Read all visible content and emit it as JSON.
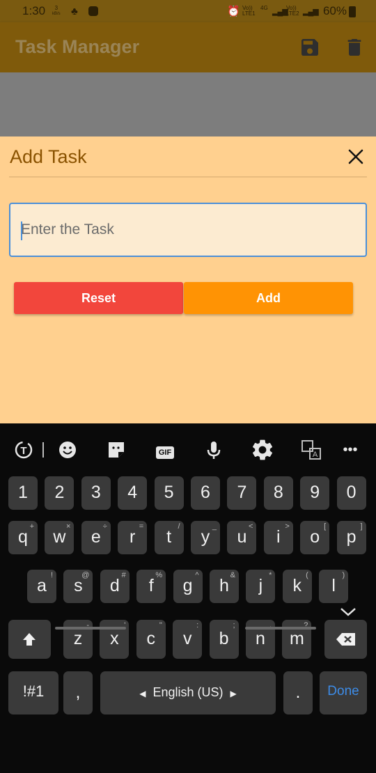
{
  "status_bar": {
    "time": "1:30",
    "data_speed_top": "3",
    "data_speed_bottom": "kB/s",
    "sim1": "Vo)) LTE1",
    "net": "4G",
    "sim2": "Vo)) LTE2",
    "battery": "60%"
  },
  "app_bar": {
    "title": "Task Manager",
    "icons": [
      "save-icon",
      "trash-icon"
    ]
  },
  "sheet": {
    "title": "Add Task",
    "close_icon": "close-icon",
    "input_placeholder": "Enter the Task",
    "input_value": "",
    "reset_label": "Reset",
    "add_label": "Add",
    "colors": {
      "reset": "#f2463c",
      "add": "#ff9304",
      "focus": "#4a8fd9"
    }
  },
  "keyboard": {
    "toolbar": [
      "text-recognition-icon",
      "emoji-icon",
      "sticker-icon",
      "gif-icon",
      "microphone-icon",
      "settings-icon",
      "translate-icon",
      "more-icon"
    ],
    "gif_label": "GIF",
    "number_row": [
      "1",
      "2",
      "3",
      "4",
      "5",
      "6",
      "7",
      "8",
      "9",
      "0"
    ],
    "row1": [
      {
        "k": "q",
        "s": "+"
      },
      {
        "k": "w",
        "s": "×"
      },
      {
        "k": "e",
        "s": "÷"
      },
      {
        "k": "r",
        "s": "="
      },
      {
        "k": "t",
        "s": "/"
      },
      {
        "k": "y",
        "s": "_"
      },
      {
        "k": "u",
        "s": "<"
      },
      {
        "k": "i",
        "s": ">"
      },
      {
        "k": "o",
        "s": "["
      },
      {
        "k": "p",
        "s": "]"
      }
    ],
    "row2": [
      {
        "k": "a",
        "s": "!"
      },
      {
        "k": "s",
        "s": "@"
      },
      {
        "k": "d",
        "s": "#"
      },
      {
        "k": "f",
        "s": "%"
      },
      {
        "k": "g",
        "s": "^"
      },
      {
        "k": "h",
        "s": "&"
      },
      {
        "k": "j",
        "s": "*"
      },
      {
        "k": "k",
        "s": "("
      },
      {
        "k": "l",
        "s": ")"
      }
    ],
    "row3": [
      {
        "k": "z",
        "s": "-"
      },
      {
        "k": "x",
        "s": "'"
      },
      {
        "k": "c",
        "s": "\""
      },
      {
        "k": "v",
        "s": ":"
      },
      {
        "k": "b",
        "s": ";"
      },
      {
        "k": "n",
        "s": ","
      },
      {
        "k": "m",
        "s": "?"
      }
    ],
    "symbols_label": "!#1",
    "comma_label": ",",
    "space_label": "English (US)",
    "period_label": ".",
    "done_label": "Done",
    "done_color": "#3d8ce8"
  }
}
